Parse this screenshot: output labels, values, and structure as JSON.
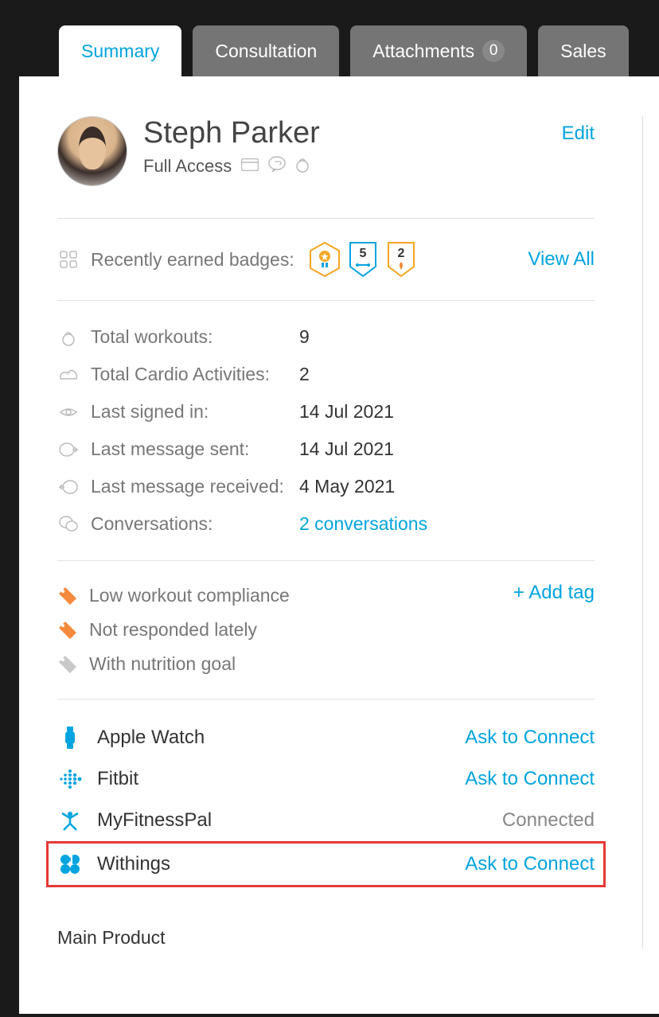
{
  "tabs": {
    "summary": "Summary",
    "consultation": "Consultation",
    "attachments": "Attachments",
    "attachments_count": "0",
    "sales": "Sales"
  },
  "profile": {
    "name": "Steph Parker",
    "access": "Full Access",
    "edit": "Edit"
  },
  "badges": {
    "label": "Recently earned badges:",
    "b2_value": "5",
    "b3_value": "2",
    "view_all": "View All"
  },
  "stats": {
    "total_workouts_label": "Total workouts:",
    "total_workouts_value": "9",
    "total_cardio_label": "Total Cardio Activities:",
    "total_cardio_value": "2",
    "last_signin_label": "Last signed in:",
    "last_signin_value": "14 Jul 2021",
    "last_msg_sent_label": "Last message sent:",
    "last_msg_sent_value": "14 Jul 2021",
    "last_msg_recv_label": "Last message received:",
    "last_msg_recv_value": "4 May 2021",
    "conversations_label": "Conversations:",
    "conversations_value": "2 conversations"
  },
  "tags": {
    "add": "+ Add tag",
    "t1": "Low workout compliance",
    "t2": "Not responded lately",
    "t3": "With nutrition goal"
  },
  "integrations": {
    "apple_watch": "Apple Watch",
    "fitbit": "Fitbit",
    "myfitnesspal": "MyFitnessPal",
    "withings": "Withings",
    "ask": "Ask to Connect",
    "connected": "Connected"
  },
  "footer": {
    "main_product": "Main Product"
  }
}
